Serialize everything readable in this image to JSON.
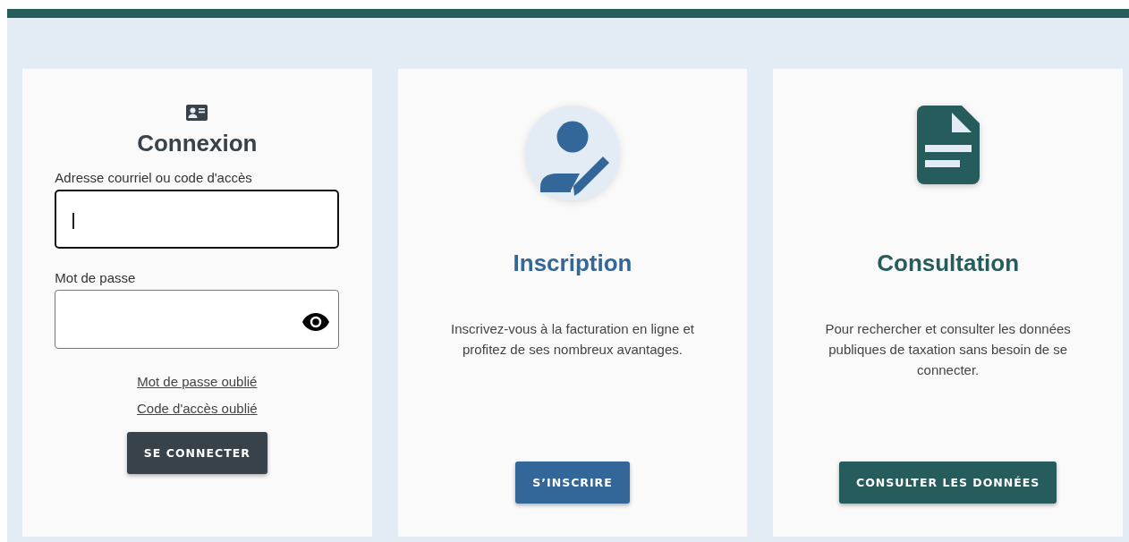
{
  "login": {
    "title": "Connexion",
    "fields": [
      {
        "label": "Adresse courriel ou code d'accès",
        "kind": "text",
        "focused": true
      },
      {
        "label": "Mot de passe",
        "kind": "password",
        "focused": false
      }
    ],
    "links": [
      "Mot de passe oublié",
      "Code d'accès oublié"
    ],
    "button": "SE CONNECTER"
  },
  "cards": [
    {
      "kind": "signup",
      "title": "Inscription",
      "text": "Inscrivez-vous à la facturation en ligne et profitez de ses nombreux avantages.",
      "button": "S’INSCRIRE"
    },
    {
      "kind": "consult",
      "title": "Consultation",
      "text": "Pour rechercher et consulter les données publiques de taxation sans besoin de se connecter.",
      "button": "CONSULTER LES DONNÉES"
    }
  ]
}
